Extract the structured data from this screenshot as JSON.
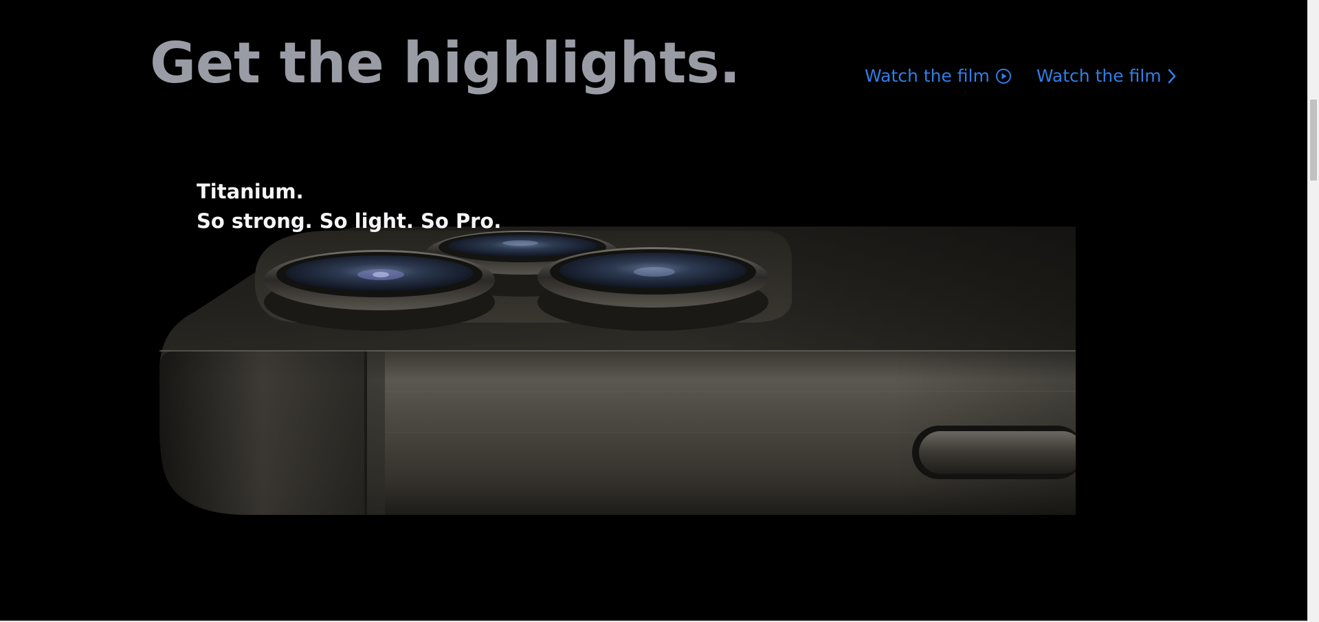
{
  "headline": "Get the highlights.",
  "links": [
    {
      "label": "Watch the film",
      "icon": "play-circle-icon"
    },
    {
      "label": "Watch the film",
      "icon": "chevron-right-icon"
    }
  ],
  "slide": {
    "title": "Titanium.",
    "subtitle": "So strong. So light. So Pro."
  },
  "colors": {
    "background": "#000000",
    "headline": "#9a9ca5",
    "link": "#2f7fe8",
    "caption": "#f5f5f7"
  }
}
